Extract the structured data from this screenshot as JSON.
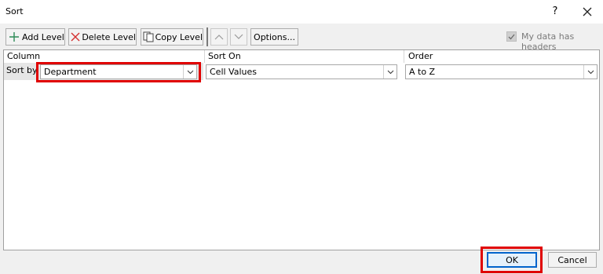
{
  "window": {
    "title": "Sort",
    "help": "?"
  },
  "toolbar": {
    "add_level": "Add Level",
    "delete_level": "Delete Level",
    "copy_level": "Copy Level",
    "options": "Options...",
    "my_data_headers": "My data has headers",
    "my_data_headers_checked": true
  },
  "grid": {
    "headers": {
      "column": "Column",
      "sort_on": "Sort On",
      "order": "Order"
    },
    "rows": [
      {
        "label": "Sort by",
        "column": "Department",
        "sort_on": "Cell Values",
        "order": "A to Z"
      }
    ]
  },
  "footer": {
    "ok": "OK",
    "cancel": "Cancel"
  },
  "colors": {
    "highlight": "#e00000",
    "accent": "#0064cc",
    "add_icon": "#2e8b57",
    "delete_icon": "#d32f2f"
  },
  "icons": [
    "plus-icon",
    "x-icon",
    "copy-icon",
    "arrow-up-icon",
    "arrow-down-icon",
    "chevron-down-icon",
    "close-icon",
    "checkmark-icon"
  ]
}
